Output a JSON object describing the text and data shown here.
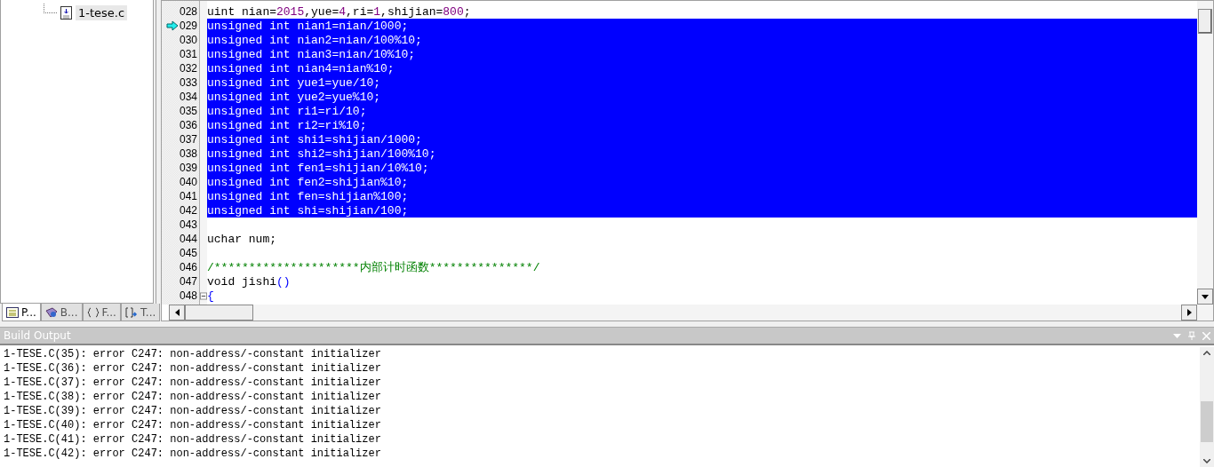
{
  "project_tree": {
    "items": [
      {
        "label": "1-tese.c",
        "selected": true
      }
    ]
  },
  "panel_tabs": [
    {
      "label": "P...",
      "selected": true
    },
    {
      "label": "B...",
      "selected": false
    },
    {
      "label": "F...",
      "selected": false
    },
    {
      "label": "T...",
      "selected": false
    }
  ],
  "editor": {
    "lines": [
      {
        "number": "028",
        "selected": false,
        "current": false,
        "fold": false,
        "segments": [
          {
            "kind": "plain",
            "text": "uint nian="
          },
          {
            "kind": "number",
            "text": "2015"
          },
          {
            "kind": "plain",
            "text": ",yue="
          },
          {
            "kind": "number",
            "text": "4"
          },
          {
            "kind": "plain",
            "text": ",ri="
          },
          {
            "kind": "number",
            "text": "1"
          },
          {
            "kind": "plain",
            "text": ",shijian="
          },
          {
            "kind": "number",
            "text": "800"
          },
          {
            "kind": "plain",
            "text": ";"
          }
        ]
      },
      {
        "number": "029",
        "selected": true,
        "current": true,
        "fold": false,
        "segments": [
          {
            "kind": "plain",
            "text": "unsigned int nian1=nian/1000;"
          }
        ]
      },
      {
        "number": "030",
        "selected": true,
        "current": false,
        "fold": false,
        "segments": [
          {
            "kind": "plain",
            "text": "unsigned int nian2=nian/100%10;"
          }
        ]
      },
      {
        "number": "031",
        "selected": true,
        "current": false,
        "fold": false,
        "segments": [
          {
            "kind": "plain",
            "text": "unsigned int nian3=nian/10%10;"
          }
        ]
      },
      {
        "number": "032",
        "selected": true,
        "current": false,
        "fold": false,
        "segments": [
          {
            "kind": "plain",
            "text": "unsigned int nian4=nian%10;"
          }
        ]
      },
      {
        "number": "033",
        "selected": true,
        "current": false,
        "fold": false,
        "segments": [
          {
            "kind": "plain",
            "text": "unsigned int yue1=yue/10;"
          }
        ]
      },
      {
        "number": "034",
        "selected": true,
        "current": false,
        "fold": false,
        "segments": [
          {
            "kind": "plain",
            "text": "unsigned int yue2=yue%10;"
          }
        ]
      },
      {
        "number": "035",
        "selected": true,
        "current": false,
        "fold": false,
        "segments": [
          {
            "kind": "plain",
            "text": "unsigned int ri1=ri/10;"
          }
        ]
      },
      {
        "number": "036",
        "selected": true,
        "current": false,
        "fold": false,
        "segments": [
          {
            "kind": "plain",
            "text": "unsigned int ri2=ri%10;"
          }
        ]
      },
      {
        "number": "037",
        "selected": true,
        "current": false,
        "fold": false,
        "segments": [
          {
            "kind": "plain",
            "text": "unsigned int shi1=shijian/1000;"
          }
        ]
      },
      {
        "number": "038",
        "selected": true,
        "current": false,
        "fold": false,
        "segments": [
          {
            "kind": "plain",
            "text": "unsigned int shi2=shijian/100%10;"
          }
        ]
      },
      {
        "number": "039",
        "selected": true,
        "current": false,
        "fold": false,
        "segments": [
          {
            "kind": "plain",
            "text": "unsigned int fen1=shijian/10%10;"
          }
        ]
      },
      {
        "number": "040",
        "selected": true,
        "current": false,
        "fold": false,
        "segments": [
          {
            "kind": "plain",
            "text": "unsigned int fen2=shijian%10;"
          }
        ]
      },
      {
        "number": "041",
        "selected": true,
        "current": false,
        "fold": false,
        "segments": [
          {
            "kind": "plain",
            "text": "unsigned int fen=shijian%100;"
          }
        ]
      },
      {
        "number": "042",
        "selected": true,
        "current": false,
        "fold": false,
        "segments": [
          {
            "kind": "plain",
            "text": "unsigned int shi=shijian/100;"
          }
        ]
      },
      {
        "number": "043",
        "selected": false,
        "current": false,
        "fold": false
      },
      {
        "number": "044",
        "selected": false,
        "current": false,
        "fold": false,
        "segments": [
          {
            "kind": "plain",
            "text": "uchar num;"
          }
        ]
      },
      {
        "number": "045",
        "selected": false,
        "current": false,
        "fold": false
      },
      {
        "number": "046",
        "selected": false,
        "current": false,
        "fold": false,
        "segments": [
          {
            "kind": "comment",
            "text": "/*********************内部计时函数***************/"
          }
        ]
      },
      {
        "number": "047",
        "selected": false,
        "current": false,
        "fold": false,
        "segments": [
          {
            "kind": "plain",
            "text": "void jishi"
          },
          {
            "kind": "punct",
            "text": "()"
          }
        ]
      },
      {
        "number": "048",
        "selected": false,
        "current": false,
        "fold": true,
        "segments": [
          {
            "kind": "punct",
            "text": "{"
          }
        ]
      }
    ]
  },
  "build_output": {
    "title": "Build Output",
    "lines": [
      "1-TESE.C(35): error C247: non-address/-constant initializer",
      "1-TESE.C(36): error C247: non-address/-constant initializer",
      "1-TESE.C(37): error C247: non-address/-constant initializer",
      "1-TESE.C(38): error C247: non-address/-constant initializer",
      "1-TESE.C(39): error C247: non-address/-constant initializer",
      "1-TESE.C(40): error C247: non-address/-constant initializer",
      "1-TESE.C(41): error C247: non-address/-constant initializer",
      "1-TESE.C(42): error C247: non-address/-constant initializer"
    ]
  }
}
